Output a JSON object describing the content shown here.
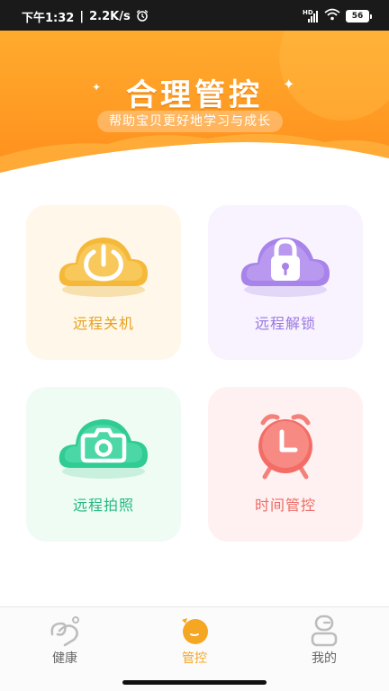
{
  "status_bar": {
    "time": "下午1:32",
    "speed": "2.2K/s",
    "network_label": "HD",
    "battery": "56"
  },
  "banner": {
    "title": "合理管控",
    "subtitle": "帮助宝贝更好地学习与成长"
  },
  "cards": [
    {
      "label": "远程关机",
      "icon": "power-cloud-icon",
      "color": "#f2a215",
      "bg": "#fff8ea"
    },
    {
      "label": "远程解锁",
      "icon": "lock-cloud-icon",
      "color": "#9d7be6",
      "bg": "#f8f3ff"
    },
    {
      "label": "远程拍照",
      "icon": "camera-cloud-icon",
      "color": "#26c08a",
      "bg": "#effcf4"
    },
    {
      "label": "时间管控",
      "icon": "alarm-clock-icon",
      "color": "#f0655f",
      "bg": "#fff1f1"
    }
  ],
  "bottom_nav": {
    "items": [
      {
        "label": "健康",
        "icon": "health-icon",
        "active": false
      },
      {
        "label": "管控",
        "icon": "control-icon",
        "active": true
      },
      {
        "label": "我的",
        "icon": "profile-icon",
        "active": false
      }
    ],
    "active_color": "#f5a623"
  }
}
